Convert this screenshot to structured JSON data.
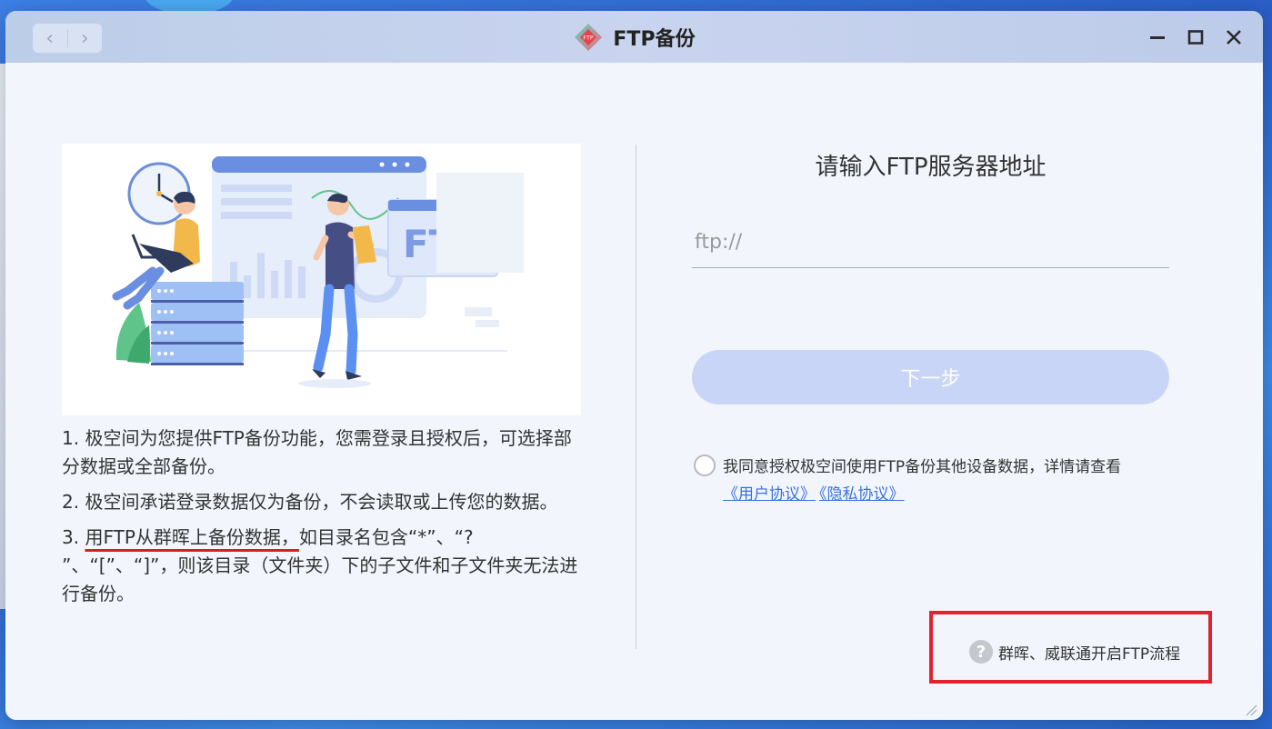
{
  "window": {
    "title": "FTP备份",
    "logo_text": "FTP"
  },
  "nav": {
    "back_glyph": "‹",
    "forward_glyph": "›"
  },
  "illustration": {
    "badge_text": "FTP"
  },
  "description": {
    "item1": "1. 极空间为您提供FTP备份功能，您需登录且授权后，可选择部分数据或全部备份。",
    "item2": "2. 极空间承诺登录数据仅为备份，不会读取或上传您的数据。",
    "item3_prefix": "3. ",
    "item3_highlight": "用FTP从群晖上备份数据，",
    "item3_rest": "如目录名包含“*”、“? ”、“[”、“]”，则该目录（文件夹）下的子文件和子文件夹无法进行备份。"
  },
  "form": {
    "title": "请输入FTP服务器地址",
    "address_placeholder": "ftp://",
    "address_value": "",
    "next_label": "下一步"
  },
  "agreement": {
    "text": "我同意授权极空间使用FTP备份其他设备数据，详情请查看",
    "user_agreement": "《用户协议》",
    "privacy_policy": "《隐私协议》"
  },
  "help": {
    "icon_glyph": "?",
    "label": "群晖、威联通开启FTP流程"
  },
  "colors": {
    "accent": "#3d6fe0",
    "button_disabled": "#c8d5f6",
    "highlight_box": "#e12330"
  }
}
